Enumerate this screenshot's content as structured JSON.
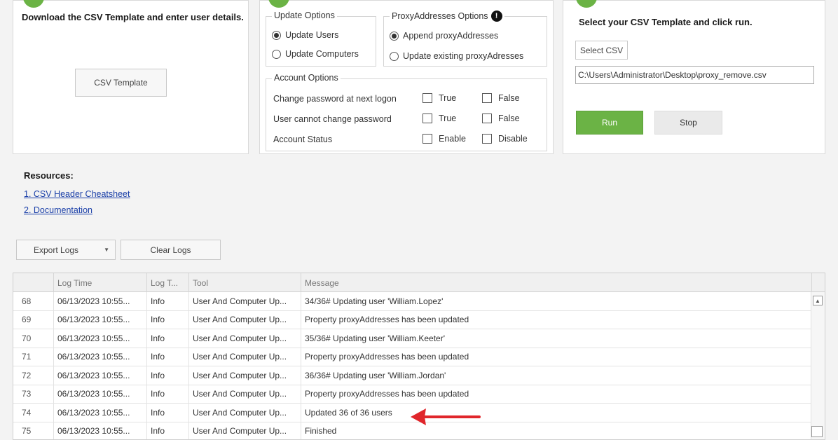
{
  "step1": {
    "instructions": "Download the CSV Template and enter user details.",
    "csv_template_button": "CSV Template"
  },
  "step2": {
    "update_options_title": "Update Options",
    "update_users": "Update Users",
    "update_computers": "Update Computers",
    "proxy_options_title": "ProxyAddresses Options",
    "append_proxy": "Append proxyAddresses",
    "update_existing_proxy": "Update existing proxyAdresses",
    "account_options_title": "Account Options",
    "account_rows": [
      {
        "label": "Change password at next logon",
        "opt1": "True",
        "opt2": "False"
      },
      {
        "label": "User cannot change password",
        "opt1": "True",
        "opt2": "False"
      },
      {
        "label": "Account Status",
        "opt1": "Enable",
        "opt2": "Disable"
      }
    ]
  },
  "step3": {
    "instructions": "Select your CSV Template and click run.",
    "select_csv_button": "Select CSV",
    "csv_path": "C:\\Users\\Administrator\\Desktop\\proxy_remove.csv",
    "run_button": "Run",
    "stop_button": "Stop"
  },
  "resources": {
    "title": "Resources:",
    "links": [
      "1. CSV Header Cheatsheet",
      "2. Documentation"
    ]
  },
  "log_toolbar": {
    "export_logs": "Export Logs",
    "clear_logs": "Clear Logs"
  },
  "log_grid": {
    "columns": [
      "",
      "Log Time",
      "Log T...",
      "Tool",
      "Message"
    ],
    "rows": [
      {
        "num": "68",
        "time": "06/13/2023 10:55...",
        "type": "Info",
        "tool": "User And Computer Up...",
        "message": "34/36# Updating user 'William.Lopez'"
      },
      {
        "num": "69",
        "time": "06/13/2023 10:55...",
        "type": "Info",
        "tool": "User And Computer Up...",
        "message": " Property proxyAddresses has been updated"
      },
      {
        "num": "70",
        "time": "06/13/2023 10:55...",
        "type": "Info",
        "tool": "User And Computer Up...",
        "message": "35/36# Updating user 'William.Keeter'"
      },
      {
        "num": "71",
        "time": "06/13/2023 10:55...",
        "type": "Info",
        "tool": "User And Computer Up...",
        "message": " Property proxyAddresses has been updated"
      },
      {
        "num": "72",
        "time": "06/13/2023 10:55...",
        "type": "Info",
        "tool": "User And Computer Up...",
        "message": "36/36# Updating user 'William.Jordan'"
      },
      {
        "num": "73",
        "time": "06/13/2023 10:55...",
        "type": "Info",
        "tool": "User And Computer Up...",
        "message": " Property proxyAddresses has been updated"
      },
      {
        "num": "74",
        "time": "06/13/2023 10:55...",
        "type": "Info",
        "tool": "User And Computer Up...",
        "message": "Updated 36 of 36 users"
      },
      {
        "num": "75",
        "time": "06/13/2023 10:55...",
        "type": "Info",
        "tool": "User And Computer Up...",
        "message": "Finished"
      }
    ]
  },
  "colors": {
    "run_green": "#6bb345",
    "step_green": "#6bb345",
    "link_blue": "#1a3fa8",
    "arrow_red": "#e0262b"
  }
}
